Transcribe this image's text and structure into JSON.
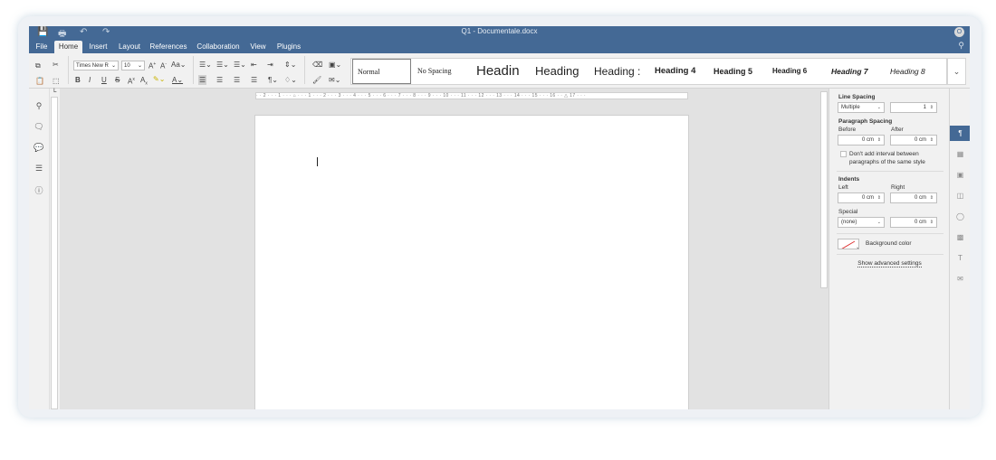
{
  "window": {
    "title": "Q1 - Documentale.docx",
    "user_initial": "O"
  },
  "tabs": [
    "File",
    "Home",
    "Insert",
    "Layout",
    "References",
    "Collaboration",
    "View",
    "Plugins"
  ],
  "active_tab": "Home",
  "toolbar": {
    "font_name": "Times New R",
    "font_size": "10"
  },
  "styles": [
    {
      "label": "Normal"
    },
    {
      "label": "No Spacing"
    },
    {
      "label": "Headin"
    },
    {
      "label": "Heading"
    },
    {
      "label": "Heading :"
    },
    {
      "label": "Heading 4"
    },
    {
      "label": "Heading 5"
    },
    {
      "label": "Heading 6"
    },
    {
      "label": "Heading 7"
    },
    {
      "label": "Heading 8"
    }
  ],
  "ruler": {
    "horizontal": "· · 2 · · · 1 · · · ⌂ · · · 1 · · · 2 · · · 3 · · · 4 · · · 5 · · · 6 · · · 7 · · · 8 · · · 9 · · · 10 · · · 11 · · · 12 · · · 13 · · · 14 · · · 15 · · · 16 · · △ 17 · · ·"
  },
  "panel": {
    "line_spacing": {
      "label": "Line Spacing",
      "mode": "Multiple",
      "value": "1"
    },
    "paragraph_spacing": {
      "label": "Paragraph Spacing",
      "before_label": "Before",
      "after_label": "After",
      "before": "0 cm",
      "after": "0 cm"
    },
    "dont_add_interval": {
      "line1": "Don't add interval between",
      "line2": "paragraphs of the same style",
      "checked": false
    },
    "indents": {
      "label": "Indents",
      "left_label": "Left",
      "right_label": "Right",
      "left": "0 cm",
      "right": "0 cm"
    },
    "special": {
      "label": "Special",
      "mode": "(none)",
      "value": "0 cm"
    },
    "background_color": "Background color",
    "advanced": "Show advanced settings"
  },
  "colors": {
    "titlebar": "#446995",
    "toolbar": "#f1f1f1",
    "docarea": "#e2e2e2"
  }
}
